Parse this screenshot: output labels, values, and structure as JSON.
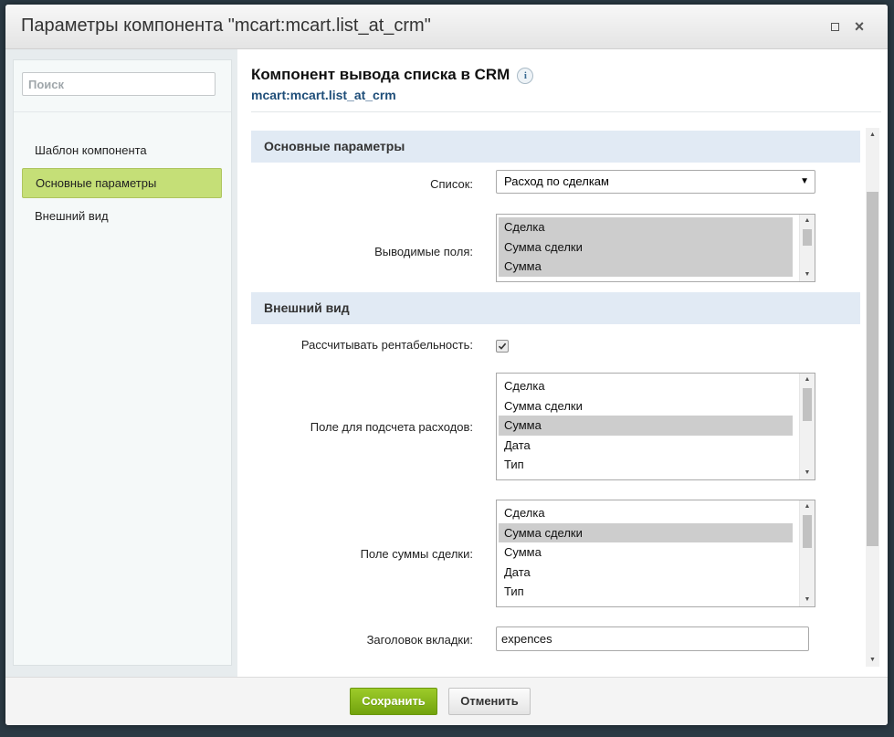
{
  "dialog": {
    "title": "Параметры компонента \"mcart:mcart.list_at_crm\""
  },
  "sidebar": {
    "search_placeholder": "Поиск",
    "items": [
      {
        "label": "Шаблон компонента",
        "active": false
      },
      {
        "label": "Основные параметры",
        "active": true
      },
      {
        "label": "Внешний вид",
        "active": false
      }
    ]
  },
  "component": {
    "title": "Компонент вывода списка в CRM",
    "code": "mcart:mcart.list_at_crm",
    "info_icon": "i"
  },
  "sections": {
    "basic": {
      "header": "Основные параметры",
      "list_label": "Список:",
      "list_value": "Расход по сделкам",
      "fields_label": "Выводимые поля:",
      "fields_options": [
        "Сделка",
        "Сумма сделки",
        "Сумма"
      ]
    },
    "appearance": {
      "header": "Внешний вид",
      "profit_label": "Рассчитывать рентабельность:",
      "profit_checked": true,
      "expense_field_label": "Поле для подсчета расходов:",
      "expense_field_options": [
        "Сделка",
        "Сумма сделки",
        "Сумма",
        "Дата",
        "Тип"
      ],
      "expense_field_selected": "Сумма",
      "deal_sum_label": "Поле суммы сделки:",
      "deal_sum_options": [
        "Сделка",
        "Сумма сделки",
        "Сумма",
        "Дата",
        "Тип"
      ],
      "deal_sum_selected": "Сумма сделки",
      "tab_title_label": "Заголовок вкладки:",
      "tab_title_value": "expences"
    }
  },
  "footer": {
    "save_label": "Сохранить",
    "cancel_label": "Отменить"
  },
  "colors": {
    "save_button": "#7fb51b",
    "active_nav": "#c5df77",
    "section_header": "#e1eaf4",
    "link_blue": "#1f4e79"
  }
}
